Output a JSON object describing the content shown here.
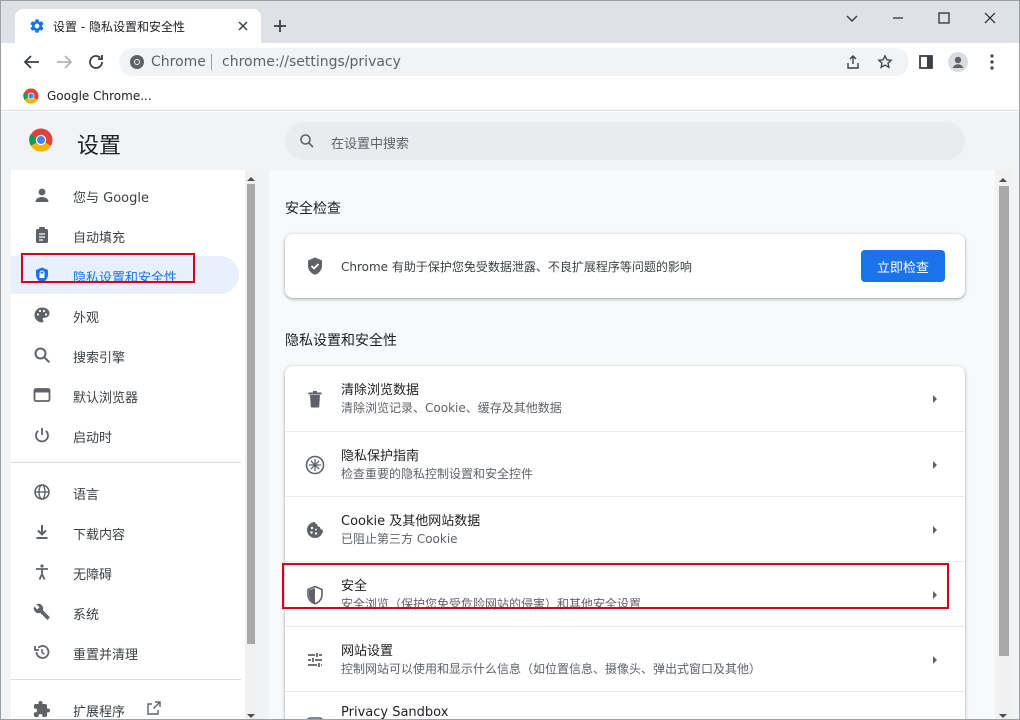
{
  "tab": {
    "title": "设置 - 隐私设置和安全性"
  },
  "omnibox": {
    "host": "Chrome",
    "url": "chrome://settings/privacy"
  },
  "bookmarks": {
    "item": "Google Chrome..."
  },
  "settings": {
    "title": "设置",
    "search_placeholder": "在设置中搜索"
  },
  "sidebar": {
    "items": [
      {
        "label": "您与 Google",
        "icon": "person-icon"
      },
      {
        "label": "自动填充",
        "icon": "clipboard-icon"
      },
      {
        "label": "隐私设置和安全性",
        "icon": "shield-icon",
        "active": true
      },
      {
        "label": "外观",
        "icon": "palette-icon"
      },
      {
        "label": "搜索引擎",
        "icon": "search-icon"
      },
      {
        "label": "默认浏览器",
        "icon": "browser-icon"
      },
      {
        "label": "启动时",
        "icon": "power-icon"
      },
      {
        "label": "语言",
        "icon": "globe-icon"
      },
      {
        "label": "下载内容",
        "icon": "download-icon"
      },
      {
        "label": "无障碍",
        "icon": "accessibility-icon"
      },
      {
        "label": "系统",
        "icon": "wrench-icon"
      },
      {
        "label": "重置并清理",
        "icon": "restore-icon"
      },
      {
        "label": "扩展程序",
        "icon": "extension-icon"
      }
    ]
  },
  "safety_check": {
    "section_title": "安全检查",
    "text": "Chrome 有助于保护您免受数据泄露、不良扩展程序等问题的影响",
    "button": "立即检查"
  },
  "privacy": {
    "section_title": "隐私设置和安全性",
    "rows": [
      {
        "title": "清除浏览数据",
        "subtitle": "清除浏览记录、Cookie、缓存及其他数据",
        "icon": "trash-icon"
      },
      {
        "title": "隐私保护指南",
        "subtitle": "检查重要的隐私控制设置和安全控件",
        "icon": "compass-icon"
      },
      {
        "title": "Cookie 及其他网站数据",
        "subtitle": "已阻止第三方 Cookie",
        "icon": "cookie-icon"
      },
      {
        "title": "安全",
        "subtitle": "安全浏览（保护您免受危险网站的侵害）和其他安全设置",
        "icon": "shield-icon"
      },
      {
        "title": "网站设置",
        "subtitle": "控制网站可以使用和显示什么信息（如位置信息、摄像头、弹出式窗口及其他）",
        "icon": "tune-icon"
      },
      {
        "title": "Privacy Sandbox",
        "subtitle": "",
        "icon": "sandbox-icon"
      }
    ]
  },
  "colors": {
    "accent": "#1a73e8",
    "highlight_box": "#d6001c",
    "active_bg": "#e8f0fe"
  }
}
